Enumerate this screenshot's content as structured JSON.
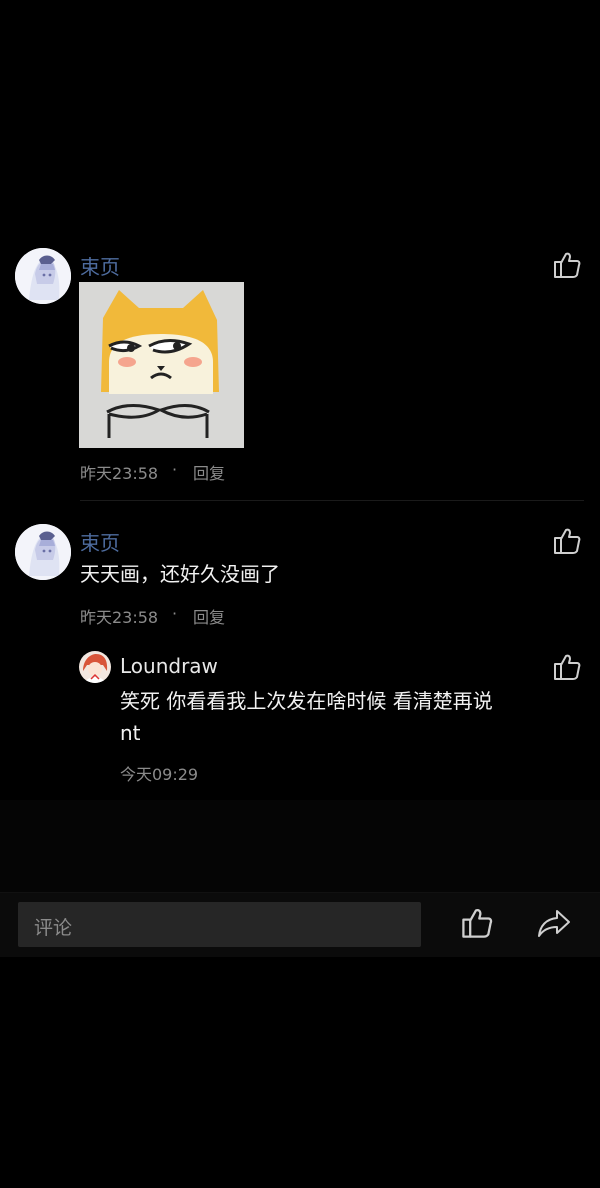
{
  "comments": [
    {
      "username": "束页",
      "time": "昨天23:58",
      "reply": "回复",
      "sticker": "shiba-sticker"
    },
    {
      "username": "束页",
      "text": "天天画，还好久没画了",
      "time": "昨天23:58",
      "reply": "回复",
      "replies": [
        {
          "username": "Loundraw",
          "text_line1": "笑死 你看看我上次发在啥时候 看清楚再说",
          "text_line2": "nt",
          "time": "今天09:29"
        }
      ]
    }
  ],
  "separator": "·",
  "bottom_bar": {
    "placeholder": "评论",
    "like_icon": "thumbs-up-icon",
    "share_icon": "share-icon"
  },
  "colors": {
    "background": "#000000",
    "username": "#4e6c9f",
    "meta": "#8b8b8b",
    "input": "#262626"
  }
}
